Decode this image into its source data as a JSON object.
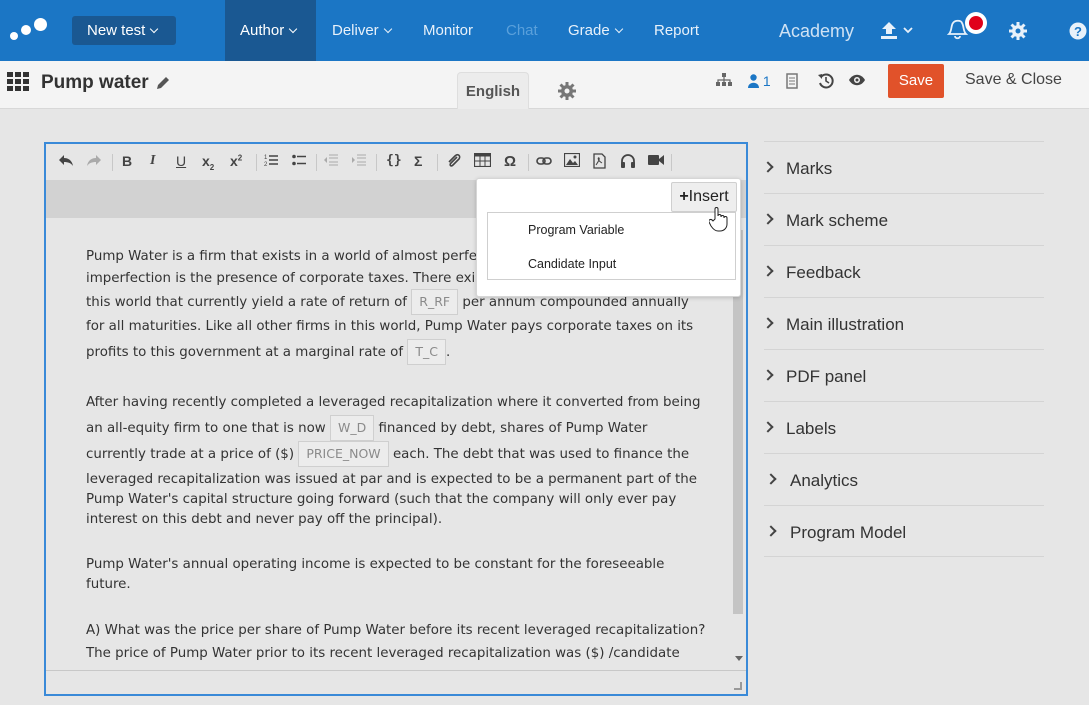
{
  "topnav": {
    "new_test_label": "New test",
    "items": [
      {
        "label": "Author",
        "dropdown": true,
        "active": true
      },
      {
        "label": "Deliver",
        "dropdown": true
      },
      {
        "label": "Monitor"
      },
      {
        "label": "Chat",
        "disabled": true
      },
      {
        "label": "Grade",
        "dropdown": true
      },
      {
        "label": "Report"
      }
    ],
    "academy": "Academy",
    "icons": [
      "logo-icon",
      "upload-icon",
      "bell-icon",
      "gear-icon",
      "help-icon"
    ],
    "accent_color": "#1b76c5",
    "notification_color": "#e0001a"
  },
  "subbar": {
    "title": "Pump water",
    "language_tab": "English",
    "participants_count": "1",
    "save_label": "Save",
    "save_close_label": "Save & Close",
    "save_color": "#e1522a"
  },
  "editor": {
    "toolbar_icons": [
      "undo-icon",
      "redo-icon",
      "bold-icon",
      "italic-icon",
      "underline-icon",
      "subscript-icon",
      "superscript-icon",
      "ordered-list-icon",
      "bullet-list-icon",
      "outdent-icon",
      "indent-icon",
      "code-icon",
      "sigma-icon",
      "attachment-icon",
      "table-icon",
      "omega-icon",
      "link-icon",
      "image-icon",
      "pdf-icon",
      "audio-icon",
      "video-icon"
    ],
    "para1": {
      "l1": "Pump Water is a firm that exists in a world of almost perfect c",
      "l2": "imperfection is the presence of corporate taxes. There exists federal government bonds in",
      "l3a": "this world that currently yield a rate of return of",
      "var_rrf": "R_RF",
      "l3b": "per annum compounded annually",
      "l4": "for all maturities. Like all other firms in this world, Pump Water pays corporate taxes on its",
      "l5a": "profits to this government at a marginal rate of",
      "var_tc": "T_C",
      "l5b": "."
    },
    "para2": {
      "l1": "After having recently completed a leveraged recapitalization where it converted from being",
      "l2a": "an all-equity firm to one that is now",
      "var_wd": "W_D",
      "l2b": "financed by debt, shares of Pump Water",
      "l3a": "currently trade at a price of ($)",
      "var_price": "PRICE_NOW",
      "l3b": "each. The debt that was used to finance the",
      "l4": "leveraged recapitalization was issued at par and is expected to be a permanent part of the",
      "l5": "Pump Water's capital structure going forward (such that the company will only ever pay",
      "l6": "interest on this debt and never pay off the principal)."
    },
    "para3": {
      "l1": "Pump Water's annual operating income is expected to be constant for the foreseeable",
      "l2": "future."
    },
    "para4": {
      "l1": "A) What was the price per share of Pump Water before its recent leveraged recapitalization?",
      "l2": "The price of Pump Water prior to its recent leveraged recapitalization was ($) /candidate"
    }
  },
  "popup": {
    "insert_label": "Insert",
    "options": [
      "Program Variable",
      "Candidate Input"
    ]
  },
  "right_panel": {
    "items": [
      "Marks",
      "Mark scheme",
      "Feedback",
      "Main illustration",
      "PDF panel",
      "Labels",
      "Analytics",
      "Program Model"
    ]
  }
}
